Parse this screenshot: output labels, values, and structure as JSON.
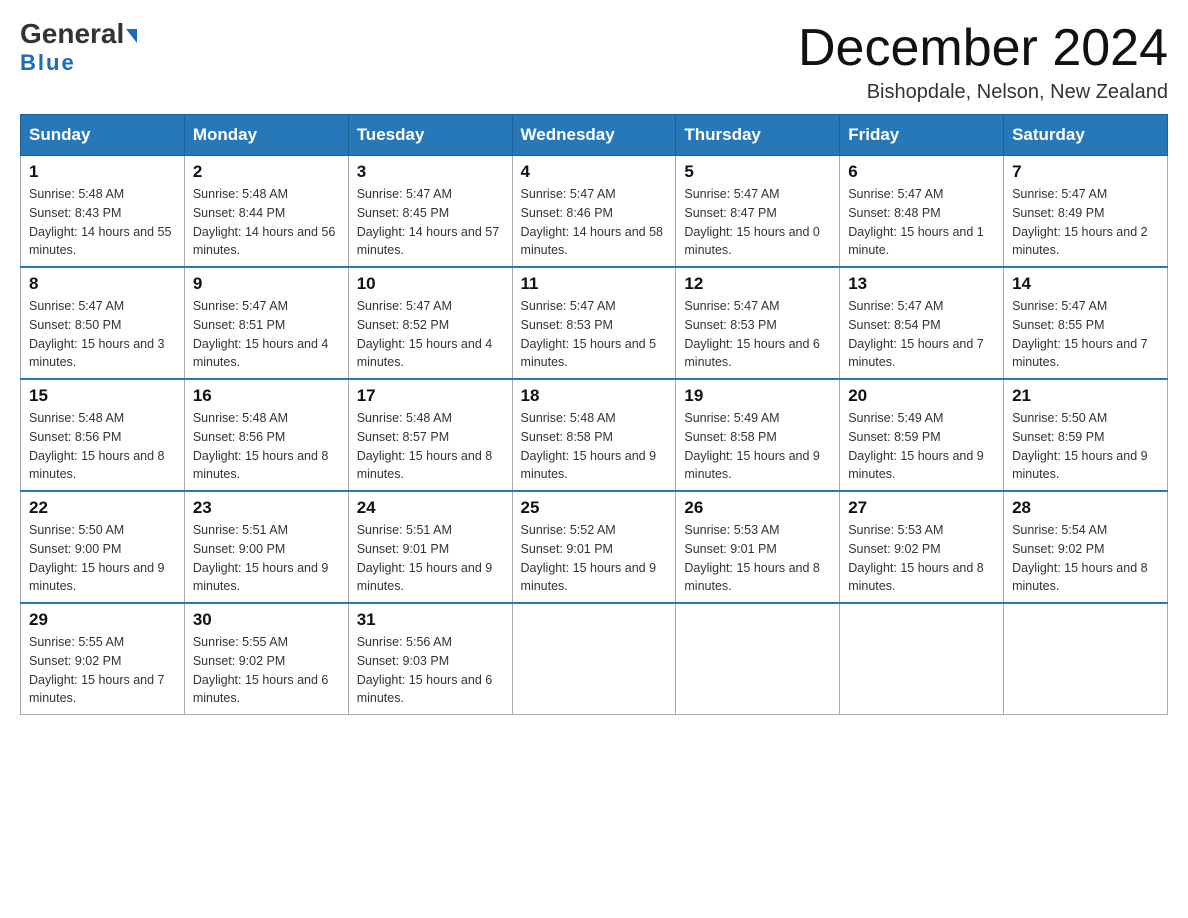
{
  "header": {
    "logo_line1": "General",
    "logo_line2": "Blue",
    "month_title": "December 2024",
    "location": "Bishopdale, Nelson, New Zealand"
  },
  "weekdays": [
    "Sunday",
    "Monday",
    "Tuesday",
    "Wednesday",
    "Thursday",
    "Friday",
    "Saturday"
  ],
  "weeks": [
    [
      {
        "day": "1",
        "sunrise": "5:48 AM",
        "sunset": "8:43 PM",
        "daylight": "14 hours and 55 minutes."
      },
      {
        "day": "2",
        "sunrise": "5:48 AM",
        "sunset": "8:44 PM",
        "daylight": "14 hours and 56 minutes."
      },
      {
        "day": "3",
        "sunrise": "5:47 AM",
        "sunset": "8:45 PM",
        "daylight": "14 hours and 57 minutes."
      },
      {
        "day": "4",
        "sunrise": "5:47 AM",
        "sunset": "8:46 PM",
        "daylight": "14 hours and 58 minutes."
      },
      {
        "day": "5",
        "sunrise": "5:47 AM",
        "sunset": "8:47 PM",
        "daylight": "15 hours and 0 minutes."
      },
      {
        "day": "6",
        "sunrise": "5:47 AM",
        "sunset": "8:48 PM",
        "daylight": "15 hours and 1 minute."
      },
      {
        "day": "7",
        "sunrise": "5:47 AM",
        "sunset": "8:49 PM",
        "daylight": "15 hours and 2 minutes."
      }
    ],
    [
      {
        "day": "8",
        "sunrise": "5:47 AM",
        "sunset": "8:50 PM",
        "daylight": "15 hours and 3 minutes."
      },
      {
        "day": "9",
        "sunrise": "5:47 AM",
        "sunset": "8:51 PM",
        "daylight": "15 hours and 4 minutes."
      },
      {
        "day": "10",
        "sunrise": "5:47 AM",
        "sunset": "8:52 PM",
        "daylight": "15 hours and 4 minutes."
      },
      {
        "day": "11",
        "sunrise": "5:47 AM",
        "sunset": "8:53 PM",
        "daylight": "15 hours and 5 minutes."
      },
      {
        "day": "12",
        "sunrise": "5:47 AM",
        "sunset": "8:53 PM",
        "daylight": "15 hours and 6 minutes."
      },
      {
        "day": "13",
        "sunrise": "5:47 AM",
        "sunset": "8:54 PM",
        "daylight": "15 hours and 7 minutes."
      },
      {
        "day": "14",
        "sunrise": "5:47 AM",
        "sunset": "8:55 PM",
        "daylight": "15 hours and 7 minutes."
      }
    ],
    [
      {
        "day": "15",
        "sunrise": "5:48 AM",
        "sunset": "8:56 PM",
        "daylight": "15 hours and 8 minutes."
      },
      {
        "day": "16",
        "sunrise": "5:48 AM",
        "sunset": "8:56 PM",
        "daylight": "15 hours and 8 minutes."
      },
      {
        "day": "17",
        "sunrise": "5:48 AM",
        "sunset": "8:57 PM",
        "daylight": "15 hours and 8 minutes."
      },
      {
        "day": "18",
        "sunrise": "5:48 AM",
        "sunset": "8:58 PM",
        "daylight": "15 hours and 9 minutes."
      },
      {
        "day": "19",
        "sunrise": "5:49 AM",
        "sunset": "8:58 PM",
        "daylight": "15 hours and 9 minutes."
      },
      {
        "day": "20",
        "sunrise": "5:49 AM",
        "sunset": "8:59 PM",
        "daylight": "15 hours and 9 minutes."
      },
      {
        "day": "21",
        "sunrise": "5:50 AM",
        "sunset": "8:59 PM",
        "daylight": "15 hours and 9 minutes."
      }
    ],
    [
      {
        "day": "22",
        "sunrise": "5:50 AM",
        "sunset": "9:00 PM",
        "daylight": "15 hours and 9 minutes."
      },
      {
        "day": "23",
        "sunrise": "5:51 AM",
        "sunset": "9:00 PM",
        "daylight": "15 hours and 9 minutes."
      },
      {
        "day": "24",
        "sunrise": "5:51 AM",
        "sunset": "9:01 PM",
        "daylight": "15 hours and 9 minutes."
      },
      {
        "day": "25",
        "sunrise": "5:52 AM",
        "sunset": "9:01 PM",
        "daylight": "15 hours and 9 minutes."
      },
      {
        "day": "26",
        "sunrise": "5:53 AM",
        "sunset": "9:01 PM",
        "daylight": "15 hours and 8 minutes."
      },
      {
        "day": "27",
        "sunrise": "5:53 AM",
        "sunset": "9:02 PM",
        "daylight": "15 hours and 8 minutes."
      },
      {
        "day": "28",
        "sunrise": "5:54 AM",
        "sunset": "9:02 PM",
        "daylight": "15 hours and 8 minutes."
      }
    ],
    [
      {
        "day": "29",
        "sunrise": "5:55 AM",
        "sunset": "9:02 PM",
        "daylight": "15 hours and 7 minutes."
      },
      {
        "day": "30",
        "sunrise": "5:55 AM",
        "sunset": "9:02 PM",
        "daylight": "15 hours and 6 minutes."
      },
      {
        "day": "31",
        "sunrise": "5:56 AM",
        "sunset": "9:03 PM",
        "daylight": "15 hours and 6 minutes."
      },
      null,
      null,
      null,
      null
    ]
  ],
  "labels": {
    "sunrise": "Sunrise:",
    "sunset": "Sunset:",
    "daylight": "Daylight:"
  }
}
